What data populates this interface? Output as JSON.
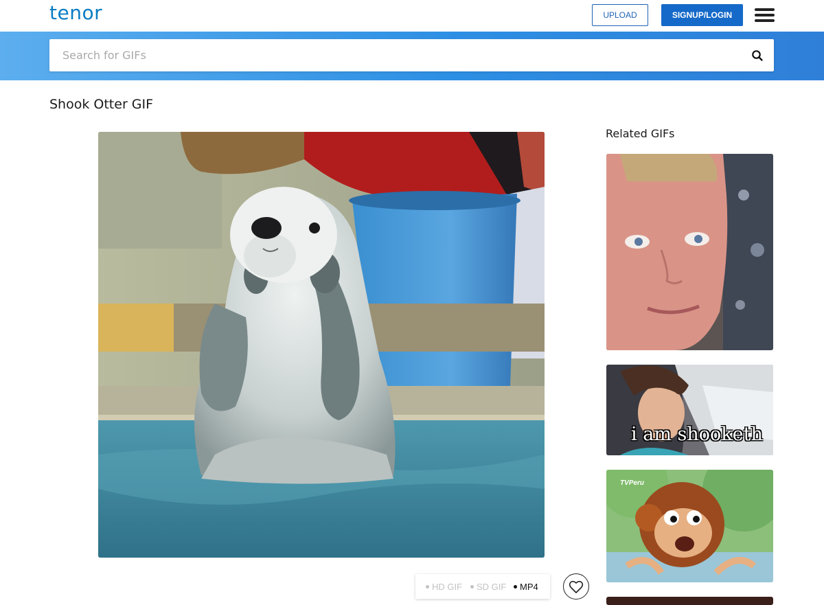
{
  "header": {
    "logo": "tenor",
    "upload_label": "UPLOAD",
    "signup_label": "SIGNUP/LOGIN"
  },
  "search": {
    "placeholder": "Search for GIFs",
    "value": ""
  },
  "gif": {
    "title": "Shook Otter GIF",
    "formats": [
      {
        "label": "HD GIF",
        "active": false
      },
      {
        "label": "SD GIF",
        "active": false
      },
      {
        "label": "MP4",
        "active": true
      }
    ]
  },
  "sidebar": {
    "title": "Related GIFs",
    "items": [
      {
        "caption": "",
        "watermark": ""
      },
      {
        "caption": "i am shooketh",
        "watermark": ""
      },
      {
        "caption": "",
        "watermark": "TVPeru"
      },
      {
        "caption": "",
        "watermark": ""
      }
    ]
  },
  "colors": {
    "brand": "#0a7cc4",
    "accent": "#1569c9",
    "band_start": "#5caeee",
    "band_end": "#2f7fd8"
  },
  "icons": {
    "search": "search-icon",
    "menu": "hamburger-menu-icon",
    "like": "heart-icon"
  }
}
